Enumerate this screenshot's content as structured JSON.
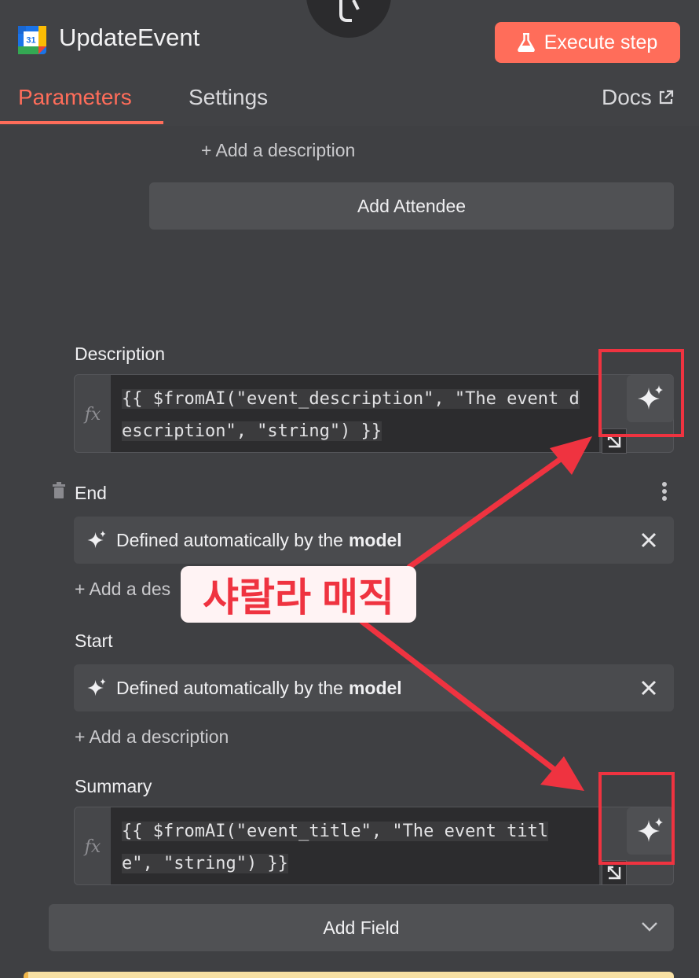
{
  "header": {
    "title": "UpdateEvent",
    "execute_label": "Execute step",
    "app_logo_text": "31"
  },
  "tabs": {
    "parameters": "Parameters",
    "settings": "Settings",
    "docs": "Docs"
  },
  "attendee": {
    "add_description": "+ Add a description",
    "add_button": "Add Attendee"
  },
  "description_field": {
    "label": "Description",
    "expr_line1": "{{ $fromAI(\"event_description\", \"The event d",
    "expr_line2": "escription\", \"string\") }}"
  },
  "end_field": {
    "label": "End",
    "auto_text": "Defined automatically by the",
    "auto_bold": "model",
    "add_description": "+ Add a des"
  },
  "start_field": {
    "label": "Start",
    "auto_text": "Defined automatically by the",
    "auto_bold": "model",
    "add_description": "+ Add a description"
  },
  "summary_field": {
    "label": "Summary",
    "expr_line1": "{{ $fromAI(\"event_title\", \"The event titl",
    "expr_line2": "e\", \"string\") }}"
  },
  "add_field_label": "Add Field",
  "annotation": {
    "callout_text": "샤랄라 매직",
    "color": "#ef3340"
  },
  "colors": {
    "accent": "#ff6d5a",
    "background": "#3f4043"
  }
}
